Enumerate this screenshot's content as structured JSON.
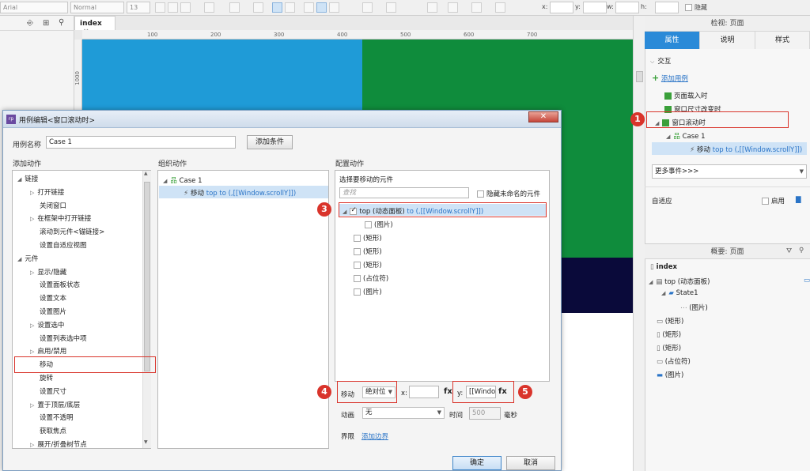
{
  "toolbar": {
    "font": "Arial",
    "style": "Normal",
    "size": "13",
    "x_label": "x:",
    "y_label": "y:",
    "w_label": "w:",
    "h_label": "h:",
    "hidden_label": "隐藏"
  },
  "canvas": {
    "tab_label": "index",
    "tab_close": "×",
    "ruler_ticks": [
      "100",
      "200",
      "300",
      "400",
      "500",
      "600",
      "700"
    ],
    "ruler_left_tick": "1000"
  },
  "right_panel": {
    "title": "检视: 页面",
    "tabs": [
      "属性",
      "说明",
      "样式"
    ],
    "interaction_header": "交互",
    "add_case": "添加用例",
    "events": [
      "页面载入时",
      "窗口尺寸改变时",
      "窗口滚动时"
    ],
    "case_name": "Case 1",
    "action_move_prefix": "移动",
    "action_move_detail": "top to (,[[Window.scrollY]])",
    "more_events": "更多事件>>>",
    "adaptive_label": "自适应",
    "enable_label": "启用",
    "outline_title": "概要: 页面",
    "outline_items": [
      "index",
      "top (动态面板)",
      "State1",
      "(图片)",
      "(矩形)",
      "(矩形)",
      "(矩形)",
      "(占位符)",
      "(图片)"
    ]
  },
  "dialog": {
    "title": "用例编辑<窗口滚动时>",
    "close_glyph": "✕",
    "case_name_label": "用例名称",
    "case_name_value": "Case 1",
    "add_condition": "添加条件",
    "add_action_header": "添加动作",
    "organize_header": "组织动作",
    "configure_header": "配置动作",
    "actions_tree": [
      {
        "label": "链接",
        "level": 0,
        "tri": "◢"
      },
      {
        "label": "打开链接",
        "level": 1,
        "tri": "▷"
      },
      {
        "label": "关闭窗口",
        "level": 1,
        "tri": ""
      },
      {
        "label": "在框架中打开链接",
        "level": 1,
        "tri": "▷"
      },
      {
        "label": "滚动到元件<锚链接>",
        "level": 1,
        "tri": ""
      },
      {
        "label": "设置自适应视图",
        "level": 1,
        "tri": ""
      },
      {
        "label": "元件",
        "level": 0,
        "tri": "◢"
      },
      {
        "label": "显示/隐藏",
        "level": 1,
        "tri": "▷"
      },
      {
        "label": "设置面板状态",
        "level": 1,
        "tri": ""
      },
      {
        "label": "设置文本",
        "level": 1,
        "tri": ""
      },
      {
        "label": "设置图片",
        "level": 1,
        "tri": ""
      },
      {
        "label": "设置选中",
        "level": 1,
        "tri": "▷"
      },
      {
        "label": "设置列表选中项",
        "level": 1,
        "tri": ""
      },
      {
        "label": "启用/禁用",
        "level": 1,
        "tri": "▷"
      },
      {
        "label": "移动",
        "level": 1,
        "tri": ""
      },
      {
        "label": "旋转",
        "level": 1,
        "tri": ""
      },
      {
        "label": "设置尺寸",
        "level": 1,
        "tri": ""
      },
      {
        "label": "置于顶层/底层",
        "level": 1,
        "tri": "▷"
      },
      {
        "label": "设置不透明",
        "level": 1,
        "tri": ""
      },
      {
        "label": "获取焦点",
        "level": 1,
        "tri": ""
      },
      {
        "label": "展开/折叠树节点",
        "level": 1,
        "tri": "▷"
      }
    ],
    "organize_case": "Case 1",
    "organize_action_prefix": "移动",
    "organize_action_detail": "top to (,[[Window.scrollY]])",
    "select_widget_label": "选择要移动的元件",
    "search_placeholder": "查找",
    "hide_unnamed": "隐藏未命名的元件",
    "widget_top_name": "top (动态面板)",
    "widget_top_detail": "to (,[[Window.scrollY]])",
    "widget_list": [
      "(图片)",
      "(矩形)",
      "(矩形)",
      "(矩形)",
      "(占位符)",
      "(图片)"
    ],
    "move_label": "移动",
    "move_mode": "绝对位",
    "x_label": "x:",
    "y_label": "y:",
    "y_value": "[[Window",
    "fx": "fx",
    "animation_label": "动画",
    "animation_value": "无",
    "time_label": "时间",
    "time_value": "500",
    "ms_label": "毫秒",
    "bounds_label": "界限",
    "add_bounds": "添加边界",
    "ok": "确定",
    "cancel": "取消"
  },
  "badges": [
    "1",
    "2",
    "3",
    "4",
    "5"
  ],
  "colors": {
    "accent": "#2a8ad8",
    "badge": "#d9342b",
    "canvas_blue": "#1f9bd7",
    "canvas_green": "#0f8c3c",
    "canvas_navy": "#0a0a3a"
  }
}
